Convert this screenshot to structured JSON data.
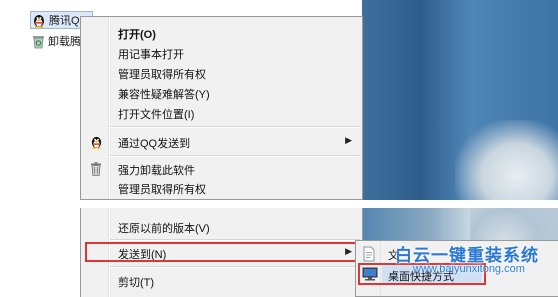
{
  "desktop": {
    "items": [
      {
        "label": "腾讯QQ",
        "icon": "qq-penguin-icon",
        "selected": true
      },
      {
        "label": "卸载腾讯",
        "icon": "recycle-bin-icon",
        "selected": false
      }
    ]
  },
  "context_menu": {
    "items": [
      {
        "label": "打开(O)",
        "bold": true
      },
      {
        "label": "用记事本打开"
      },
      {
        "label": "管理员取得所有权"
      },
      {
        "label": "兼容性疑难解答(Y)"
      },
      {
        "label": "打开文件位置(I)"
      },
      {
        "label": "通过QQ发送到",
        "icon": "qq-penguin-icon",
        "submenu": true
      },
      {
        "label": "强力卸载此软件",
        "icon": "trash-icon"
      },
      {
        "label": "管理员取得所有权"
      }
    ],
    "lower_items": [
      {
        "label": "还原以前的版本(V)"
      },
      {
        "label": "发送到(N)",
        "submenu": true,
        "highlighted": true
      },
      {
        "label": "剪切(T)"
      }
    ]
  },
  "submenu": {
    "items": [
      {
        "label": "文",
        "icon": "document-icon"
      },
      {
        "label": "桌面快捷方式",
        "icon": "desktop-icon",
        "highlighted": true
      }
    ]
  },
  "watermark": {
    "text": "白云一键重装系统",
    "url": "www.baiyunxitong.com"
  },
  "colors": {
    "highlight_border": "#e03535",
    "menu_bg": "#f1f1f1",
    "watermark": "#2a78d4"
  }
}
